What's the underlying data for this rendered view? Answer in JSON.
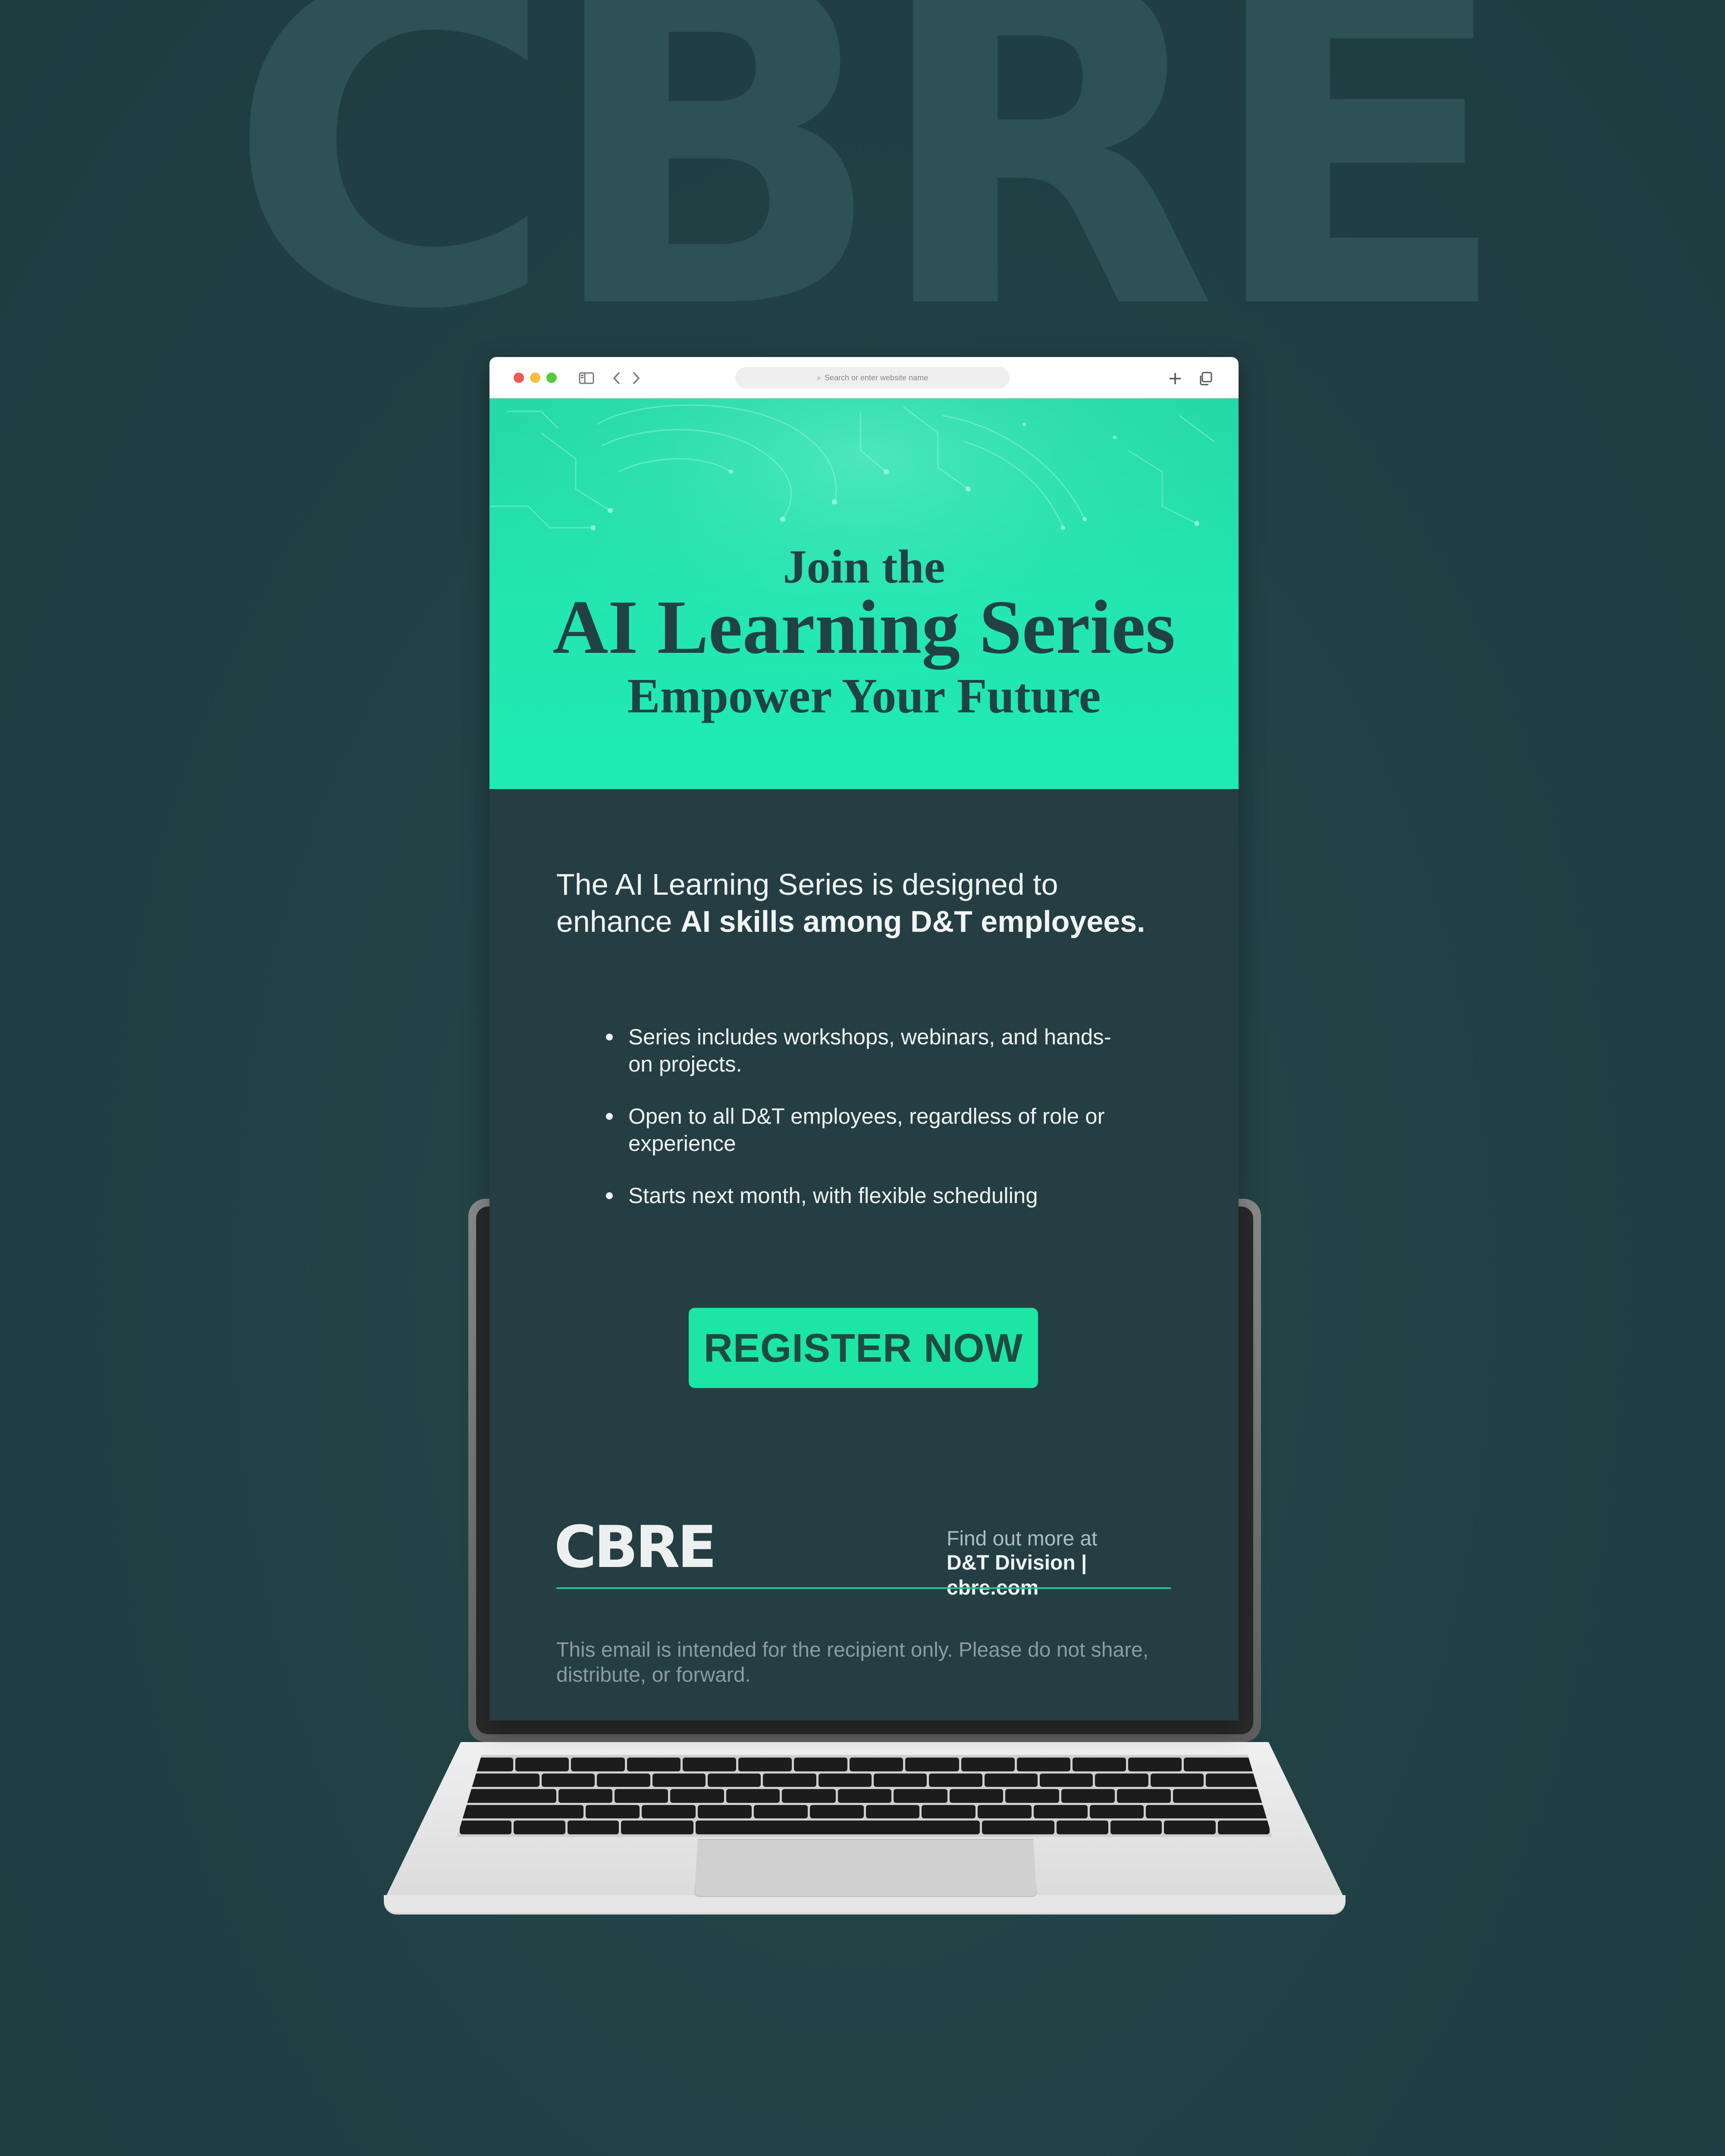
{
  "background": {
    "brand_word": "CBRE",
    "color": "#214045",
    "word_color": "#2d5154"
  },
  "browser": {
    "window_controls": [
      "close",
      "minimize",
      "maximize"
    ],
    "address_bar": {
      "placeholder": "Search or enter website name",
      "icon": "search-icon"
    },
    "icons": {
      "sidebar": "sidebar-icon",
      "back": "chevron-left-icon",
      "forward": "chevron-right-icon",
      "new_tab": "plus-icon",
      "tabs": "tabs-overview-icon"
    }
  },
  "email": {
    "hero": {
      "line1": "Join the",
      "line2": "AI Learning Series",
      "line3": "Empower Your Future",
      "accent_color": "#22e6b0",
      "text_color": "#214245"
    },
    "intro": {
      "part1": "The AI Learning Series is designed to enhance ",
      "bold": "AI skills among D&T employees."
    },
    "bullets": [
      "Series includes workshops, webinars, and hands-on projects.",
      "Open to all D&T employees, regardless of role or experience",
      "Starts next month, with flexible scheduling"
    ],
    "cta": {
      "label": "REGISTER NOW",
      "color": "#1de6a4"
    },
    "footer": {
      "logo": "CBRE",
      "find_out": "Find out more at",
      "division": "D&T Division | cbre.com",
      "divider_color": "#1fc49a",
      "disclaimer": "This email is intended for the recipient only. Please do not share, distribute, or forward."
    },
    "body_color": "#243e43"
  },
  "device": {
    "type": "laptop",
    "icons": {
      "keyboard": "keyboard-icon",
      "trackpad": "trackpad"
    }
  }
}
